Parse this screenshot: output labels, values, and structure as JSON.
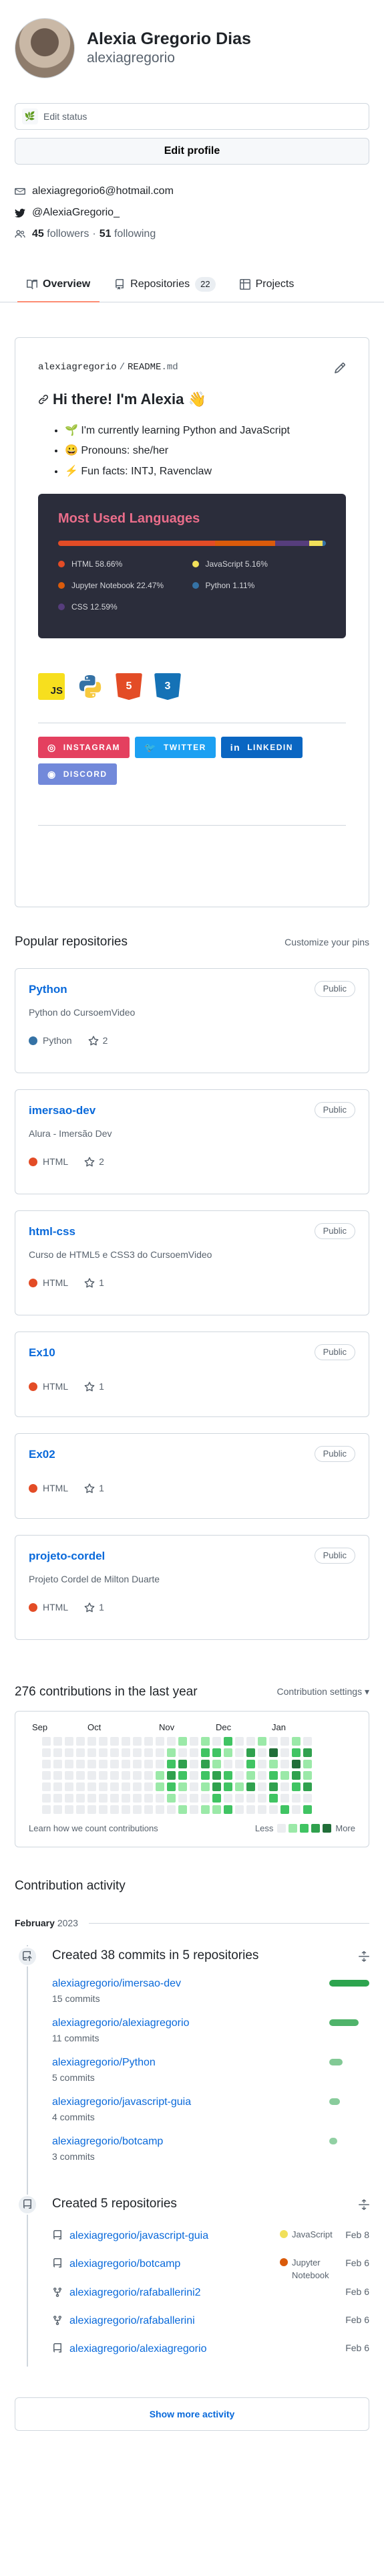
{
  "profile": {
    "full_name": "Alexia Gregorio Dias",
    "login": "alexiagregorio",
    "status": "Edit status",
    "edit_button": "Edit profile",
    "email": "alexiagregorio6@hotmail.com",
    "twitter": "@AlexiaGregorio_",
    "followers_count": "45",
    "followers_label": "followers",
    "following_count": "51",
    "following_label": "following",
    "dot": "·"
  },
  "tabs": [
    {
      "label": "Overview",
      "icon": "book-icon"
    },
    {
      "label": "Repositories",
      "icon": "repo-icon",
      "count": "22"
    },
    {
      "label": "Projects",
      "icon": "table-icon"
    }
  ],
  "readme": {
    "user": "alexiagregorio",
    "sep": "/",
    "file": "README",
    "ext": ".md",
    "heading": "Hi there! I'm Alexia 👋",
    "bullets": [
      {
        "emoji": "🌱",
        "text": "I'm currently learning Python and JavaScript"
      },
      {
        "emoji": "😀",
        "text": "Pronouns: she/her"
      },
      {
        "emoji": "⚡",
        "text": "Fun facts: INTJ, Ravenclaw"
      }
    ],
    "langcard": {
      "title": "Most Used Languages",
      "langs": [
        {
          "name": "HTML 58.66%",
          "pct": 58.66,
          "color": "#e34c26"
        },
        {
          "name": "JavaScript 5.16%",
          "pct": 5.16,
          "color": "#f1e05a"
        },
        {
          "name": "Jupyter Notebook 22.47%",
          "pct": 22.47,
          "color": "#da5b0b"
        },
        {
          "name": "Python 1.11%",
          "pct": 1.11,
          "color": "#3572a5"
        },
        {
          "name": "CSS 12.59%",
          "pct": 12.59,
          "color": "#563d7c"
        }
      ]
    },
    "tech": [
      {
        "label": "JS",
        "name": "javascript-icon"
      },
      {
        "label": "",
        "name": "python-icon"
      },
      {
        "label": "5",
        "name": "html5-icon"
      },
      {
        "label": "3",
        "name": "css3-icon"
      }
    ],
    "badges": [
      {
        "label": "INSTAGRAM",
        "color": "#e4405f",
        "icon": "◎"
      },
      {
        "label": "TWITTER",
        "color": "#1ca0f2",
        "icon": "🐦"
      },
      {
        "label": "LINKEDIN",
        "color": "#0a66c2",
        "icon": "in"
      },
      {
        "label": "DISCORD",
        "color": "#7289da",
        "icon": "◉"
      }
    ]
  },
  "popular": {
    "title": "Popular repositories",
    "customize": "Customize your pins",
    "public_label": "Public",
    "repos": [
      {
        "name": "Python",
        "desc": "Python do CursoemVideo",
        "lang": "Python",
        "lang_color": "#3572a5",
        "stars": "2"
      },
      {
        "name": "imersao-dev",
        "desc": "Alura - Imersão Dev",
        "lang": "HTML",
        "lang_color": "#e34c26",
        "stars": "2"
      },
      {
        "name": "html-css",
        "desc": "Curso de HTML5 e CSS3 do CursoemVideo",
        "lang": "HTML",
        "lang_color": "#e34c26",
        "stars": "1"
      },
      {
        "name": "Ex10",
        "desc": "",
        "lang": "HTML",
        "lang_color": "#e34c26",
        "stars": "1"
      },
      {
        "name": "Ex02",
        "desc": "",
        "lang": "HTML",
        "lang_color": "#e34c26",
        "stars": "1"
      },
      {
        "name": "projeto-cordel",
        "desc": "Projeto Cordel de Milton Duarte",
        "lang": "HTML",
        "lang_color": "#e34c26",
        "stars": "1"
      }
    ]
  },
  "contributions": {
    "title": "276 contributions in the last year",
    "settings": "Contribution settings ▾",
    "months": [
      "Sep",
      "Oct",
      "Nov",
      "Dec",
      "Jan"
    ],
    "learn": "Learn how we count contributions",
    "less": "Less",
    "more": "More"
  },
  "activity": {
    "title": "Contribution activity",
    "month": "February",
    "year": "2023",
    "commits_title": "Created 38 commits in 5 repositories",
    "commits": [
      {
        "repo": "alexiagregorio/imersao-dev",
        "count": "15 commits",
        "level": 1.0
      },
      {
        "repo": "alexiagregorio/alexiagregorio",
        "count": "11 commits",
        "level": 0.73
      },
      {
        "repo": "alexiagregorio/Python",
        "count": "5 commits",
        "level": 0.33
      },
      {
        "repo": "alexiagregorio/javascript-guia",
        "count": "4 commits",
        "level": 0.27
      },
      {
        "repo": "alexiagregorio/botcamp",
        "count": "3 commits",
        "level": 0.2
      }
    ],
    "repos_title": "Created 5 repositories",
    "repos": [
      {
        "repo": "alexiagregorio/javascript-guia",
        "lang": "JavaScript",
        "lang_color": "#f1e05a",
        "date": "Feb 8",
        "icon": "repo-icon"
      },
      {
        "repo": "alexiagregorio/botcamp",
        "lang": "Jupyter Notebook",
        "lang_color": "#da5b0b",
        "date": "Feb 6",
        "icon": "repo-icon"
      },
      {
        "repo": "alexiagregorio/rafaballerini2",
        "lang": "",
        "lang_color": "",
        "date": "Feb 6",
        "icon": "fork-icon"
      },
      {
        "repo": "alexiagregorio/rafaballerini",
        "lang": "",
        "lang_color": "",
        "date": "Feb 6",
        "icon": "fork-icon"
      },
      {
        "repo": "alexiagregorio/alexiagregorio",
        "lang": "",
        "lang_color": "",
        "date": "Feb 6",
        "icon": "repo-icon"
      }
    ],
    "show_more": "Show more activity"
  }
}
